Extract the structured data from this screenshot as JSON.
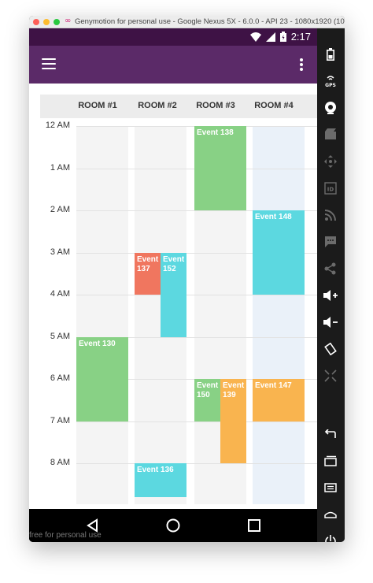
{
  "window": {
    "title": "Genymotion for personal use - Google Nexus 5X - 6.0.0 - API 23 - 1080x1920 (10..."
  },
  "status_bar": {
    "time": "2:17"
  },
  "rooms": [
    "ROOM #1",
    "ROOM #2",
    "ROOM #3",
    "ROOM #4"
  ],
  "hours": [
    "12 AM",
    "1 AM",
    "2 AM",
    "3 AM",
    "4 AM",
    "5 AM",
    "6 AM",
    "7 AM",
    "8 AM"
  ],
  "events": [
    {
      "label": "Event 138",
      "room": 2,
      "start": 0,
      "end": 2,
      "half": "full",
      "color": "#88d185"
    },
    {
      "label": "Event 148",
      "room": 3,
      "start": 2,
      "end": 4,
      "half": "full",
      "color": "#5cd8e0"
    },
    {
      "label": "Event 137",
      "room": 1,
      "start": 3,
      "end": 4,
      "half": "left",
      "color": "#f0765f"
    },
    {
      "label": "Event 152",
      "room": 1,
      "start": 3,
      "end": 5,
      "half": "right",
      "color": "#5cd8e0"
    },
    {
      "label": "Event 130",
      "room": 0,
      "start": 5,
      "end": 7,
      "half": "full",
      "color": "#88d185"
    },
    {
      "label": "Event 150",
      "room": 2,
      "start": 6,
      "end": 7,
      "half": "left",
      "color": "#88d185"
    },
    {
      "label": "Event 139",
      "room": 2,
      "start": 6,
      "end": 8,
      "half": "right",
      "color": "#f9b44f"
    },
    {
      "label": "Event 147",
      "room": 3,
      "start": 6,
      "end": 7,
      "half": "full",
      "color": "#f9b44f"
    },
    {
      "label": "Event 136",
      "room": 1,
      "start": 8,
      "end": 8.8,
      "half": "full",
      "color": "#5cd8e0"
    }
  ],
  "footer": {
    "text": "free for personal use"
  },
  "colors": {
    "app_bar": "#5b2a68",
    "status_bar": "#3e1245",
    "fab": "#9c45ad"
  },
  "side_panel_icons": [
    "battery-icon",
    "gps-icon",
    "webcam-icon",
    "capture-icon",
    "dpad-icon",
    "id-icon",
    "rss-icon",
    "sms-icon",
    "share-icon",
    "volume-up-icon",
    "volume-down-icon",
    "rotate-icon",
    "scale-icon",
    "back-icon",
    "recents-icon",
    "menu-icon",
    "home-icon",
    "power-icon"
  ]
}
